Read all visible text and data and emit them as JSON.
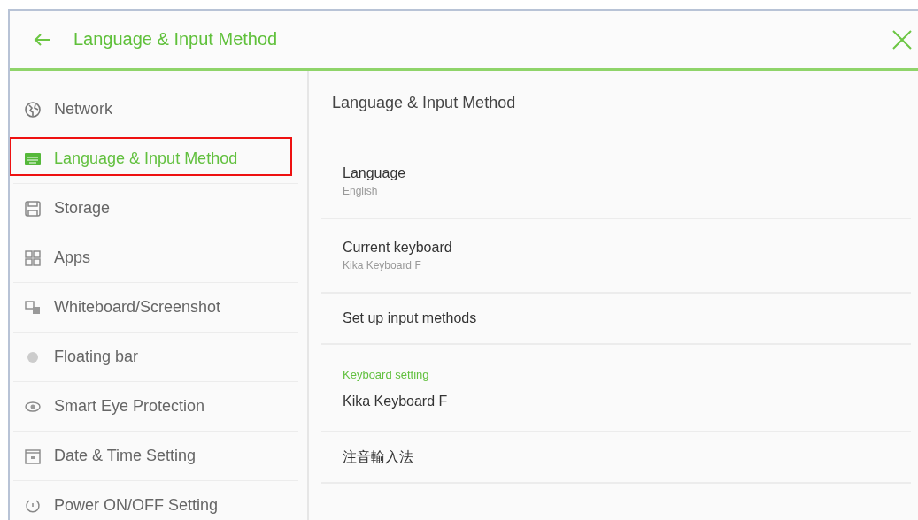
{
  "header": {
    "title": "Language & Input Method"
  },
  "sidebar": {
    "items": [
      {
        "label": "Network",
        "selected": false,
        "highlighted": false
      },
      {
        "label": "Language & Input Method",
        "selected": true,
        "highlighted": true
      },
      {
        "label": "Storage",
        "selected": false,
        "highlighted": false
      },
      {
        "label": "Apps",
        "selected": false,
        "highlighted": false
      },
      {
        "label": "Whiteboard/Screenshot",
        "selected": false,
        "highlighted": false
      },
      {
        "label": "Floating bar",
        "selected": false,
        "highlighted": false
      },
      {
        "label": "Smart Eye Protection",
        "selected": false,
        "highlighted": false
      },
      {
        "label": "Date & Time Setting",
        "selected": false,
        "highlighted": false
      },
      {
        "label": "Power ON/OFF Setting",
        "selected": false,
        "highlighted": false
      }
    ]
  },
  "content": {
    "title": "Language & Input Method",
    "rows": [
      {
        "kind": "setting",
        "label": "Language",
        "value": "English"
      },
      {
        "kind": "setting",
        "label": "Current keyboard",
        "value": "Kika Keyboard F"
      },
      {
        "kind": "setting",
        "label": "Set up input methods"
      },
      {
        "kind": "section",
        "label": "Keyboard setting"
      },
      {
        "kind": "setting",
        "label": "Kika Keyboard F"
      },
      {
        "kind": "setting",
        "label": "注音輸入法"
      }
    ]
  }
}
